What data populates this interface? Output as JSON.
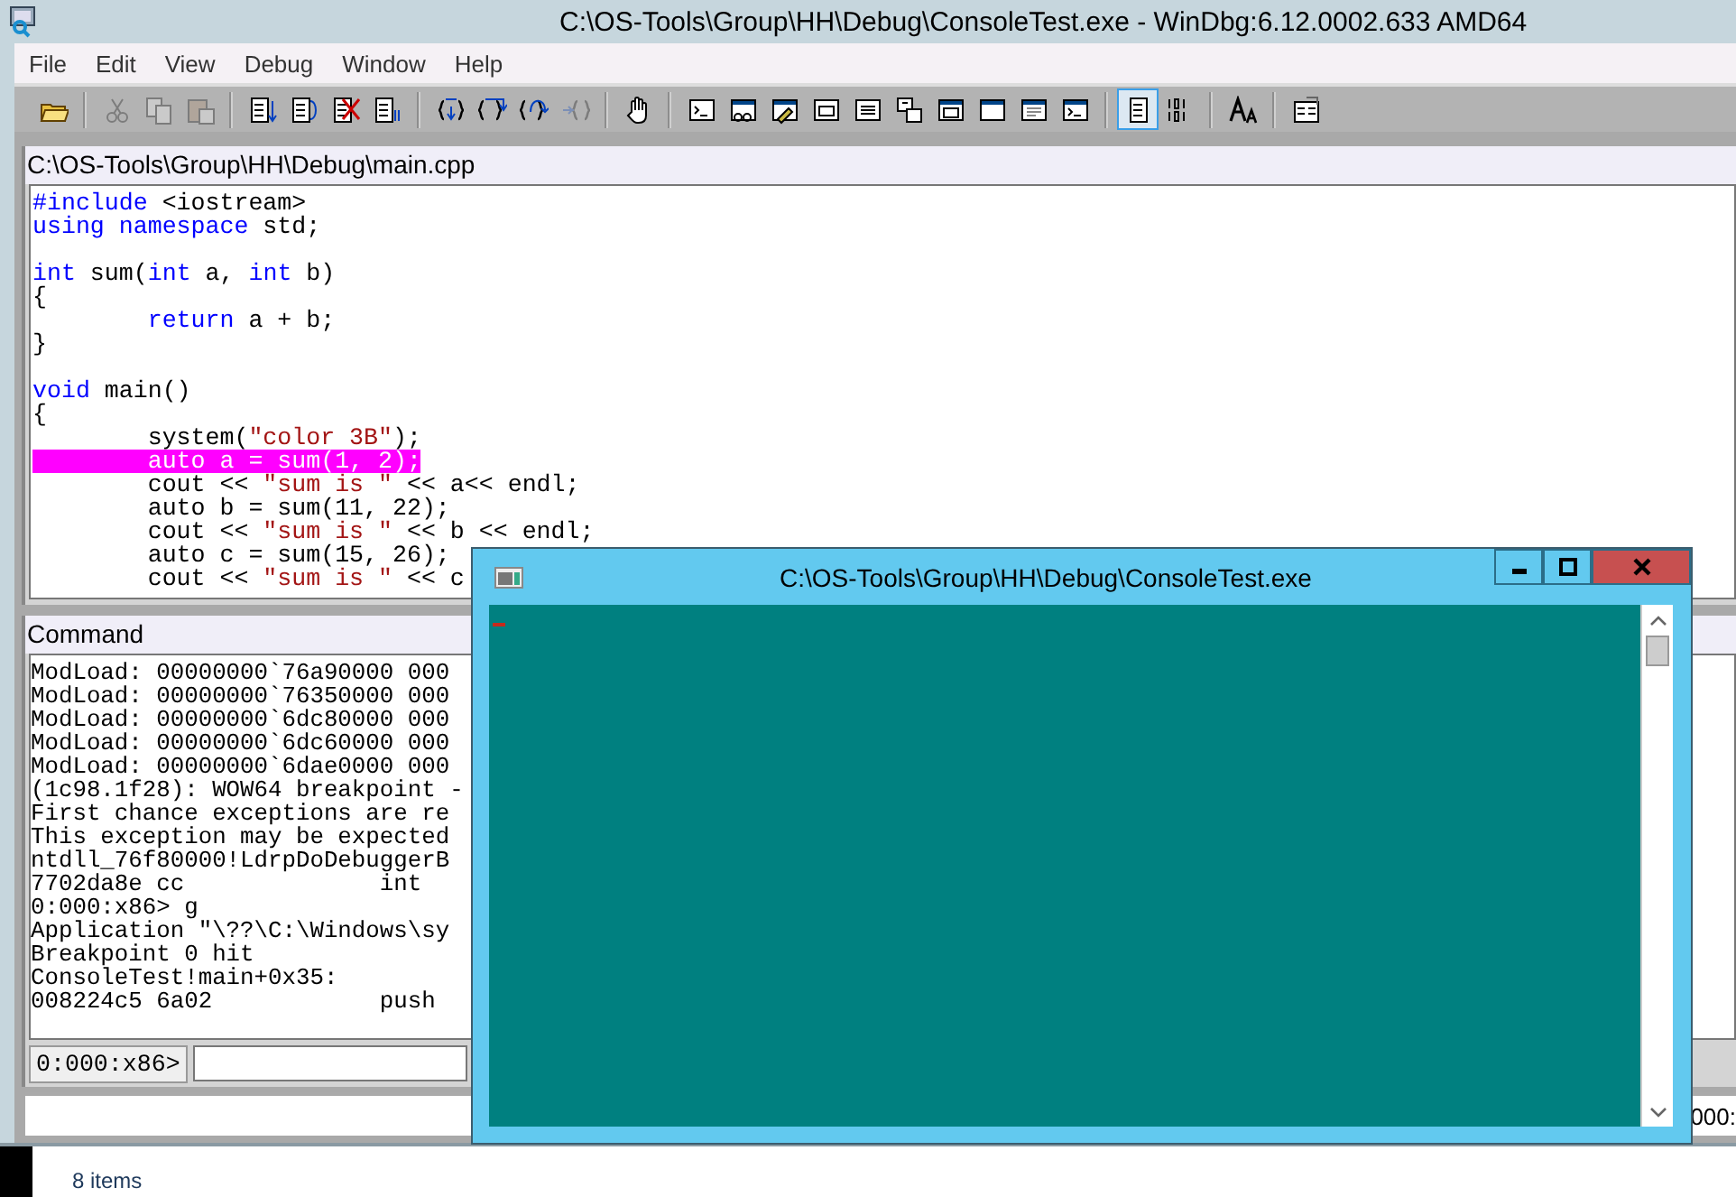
{
  "window": {
    "title": "C:\\OS-Tools\\Group\\HH\\Debug\\ConsoleTest.exe - WinDbg:6.12.0002.633 AMD64"
  },
  "menu": [
    "File",
    "Edit",
    "View",
    "Debug",
    "Window",
    "Help"
  ],
  "toolbar": [
    [
      {
        "disabled": false,
        "pressed": false
      }
    ],
    [
      {
        "disabled": true,
        "pressed": false
      },
      {
        "disabled": true,
        "pressed": false
      },
      {
        "disabled": true,
        "pressed": false
      }
    ],
    [
      {
        "disabled": false,
        "pressed": false
      },
      {
        "disabled": false,
        "pressed": false
      },
      {
        "disabled": false,
        "pressed": false
      },
      {
        "disabled": false,
        "pressed": false
      }
    ],
    [
      {
        "disabled": false,
        "pressed": false
      },
      {
        "disabled": false,
        "pressed": false
      },
      {
        "disabled": false,
        "pressed": false
      },
      {
        "disabled": true,
        "pressed": false
      }
    ],
    [
      {
        "disabled": false,
        "pressed": false
      }
    ],
    [
      {
        "disabled": false,
        "pressed": false
      },
      {
        "disabled": false,
        "pressed": false
      },
      {
        "disabled": false,
        "pressed": false
      },
      {
        "disabled": false,
        "pressed": false
      },
      {
        "disabled": false,
        "pressed": false
      },
      {
        "disabled": false,
        "pressed": false
      },
      {
        "disabled": false,
        "pressed": false
      },
      {
        "disabled": false,
        "pressed": false
      },
      {
        "disabled": false,
        "pressed": false
      },
      {
        "disabled": false,
        "pressed": false
      }
    ],
    [
      {
        "disabled": false,
        "pressed": true
      },
      {
        "disabled": false,
        "pressed": false
      }
    ],
    [
      {
        "disabled": false,
        "pressed": false
      }
    ],
    [
      {
        "disabled": false,
        "pressed": false
      }
    ]
  ],
  "source": {
    "title": "C:\\OS-Tools\\Group\\HH\\Debug\\main.cpp",
    "lines": [
      {
        "kind": "code",
        "current": false,
        "segments": [
          {
            "kind": "keyword",
            "text": "#include"
          },
          {
            "kind": "plain",
            "text": " <iostream>"
          }
        ]
      },
      {
        "kind": "code",
        "current": false,
        "segments": [
          {
            "kind": "keyword",
            "text": "using namespace"
          },
          {
            "kind": "plain",
            "text": " std;"
          }
        ]
      },
      {
        "kind": "blank"
      },
      {
        "kind": "code",
        "current": false,
        "segments": [
          {
            "kind": "keyword",
            "text": "int"
          },
          {
            "kind": "plain",
            "text": " sum("
          },
          {
            "kind": "keyword",
            "text": "int"
          },
          {
            "kind": "plain",
            "text": " a, "
          },
          {
            "kind": "keyword",
            "text": "int"
          },
          {
            "kind": "plain",
            "text": " b)"
          }
        ]
      },
      {
        "kind": "code",
        "current": false,
        "segments": [
          {
            "kind": "plain",
            "text": "{"
          }
        ]
      },
      {
        "kind": "code",
        "current": false,
        "segments": [
          {
            "kind": "keyword",
            "text": "        return"
          },
          {
            "kind": "plain",
            "text": " a + b;"
          }
        ]
      },
      {
        "kind": "code",
        "current": false,
        "segments": [
          {
            "kind": "plain",
            "text": "}"
          }
        ]
      },
      {
        "kind": "blank"
      },
      {
        "kind": "code",
        "current": false,
        "segments": [
          {
            "kind": "keyword",
            "text": "void"
          },
          {
            "kind": "plain",
            "text": " main()"
          }
        ]
      },
      {
        "kind": "code",
        "current": false,
        "segments": [
          {
            "kind": "plain",
            "text": "{"
          }
        ]
      },
      {
        "kind": "code",
        "current": false,
        "segments": [
          {
            "kind": "plain",
            "text": "        system("
          },
          {
            "kind": "string",
            "text": "\"color 3B\""
          },
          {
            "kind": "plain",
            "text": ");"
          }
        ]
      },
      {
        "kind": "code",
        "current": true,
        "segments": [
          {
            "kind": "plain",
            "text": "        auto a = sum(1, 2);"
          }
        ]
      },
      {
        "kind": "code",
        "current": false,
        "segments": [
          {
            "kind": "plain",
            "text": "        cout << "
          },
          {
            "kind": "string",
            "text": "\"sum is \""
          },
          {
            "kind": "plain",
            "text": " << a<< endl;"
          }
        ]
      },
      {
        "kind": "code",
        "current": false,
        "segments": [
          {
            "kind": "plain",
            "text": "        auto b = sum(11, 22);"
          }
        ]
      },
      {
        "kind": "code",
        "current": false,
        "segments": [
          {
            "kind": "plain",
            "text": "        cout << "
          },
          {
            "kind": "string",
            "text": "\"sum is \""
          },
          {
            "kind": "plain",
            "text": " << b << endl;"
          }
        ]
      },
      {
        "kind": "code",
        "current": false,
        "segments": [
          {
            "kind": "plain",
            "text": "        auto c = sum(15, 26);"
          }
        ]
      },
      {
        "kind": "code",
        "current": false,
        "segments": [
          {
            "kind": "plain",
            "text": "        cout << "
          },
          {
            "kind": "string",
            "text": "\"sum is \""
          },
          {
            "kind": "plain",
            "text": " << c"
          }
        ]
      }
    ]
  },
  "command": {
    "title": "Command",
    "lines": [
      "ModLoad: 00000000`76a90000 000",
      "ModLoad: 00000000`76350000 000",
      "ModLoad: 00000000`6dc80000 000",
      "ModLoad: 00000000`6dc60000 000",
      "ModLoad: 00000000`6dae0000 000",
      "(1c98.1f28): WOW64 breakpoint -",
      "First chance exceptions are re",
      "This exception may be expected",
      "ntdll_76f80000!LdrpDoDebuggerB",
      "7702da8e cc              int",
      "0:000:x86> g",
      "Application \"\\??\\C:\\Windows\\sy",
      "Breakpoint 0 hit",
      "ConsoleTest!main+0x35:",
      "008224c5 6a02            push"
    ],
    "prompt": "0:000:x86>"
  },
  "status_bar": {
    "text": "000:"
  },
  "console": {
    "title": "C:\\OS-Tools\\Group\\HH\\Debug\\ConsoleTest.exe"
  },
  "explorer_status": {
    "text": "8 items"
  }
}
